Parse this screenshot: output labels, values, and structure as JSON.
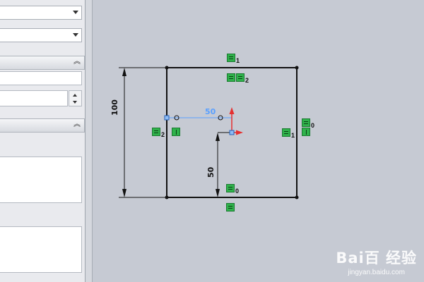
{
  "panel": {
    "combo1_value": "",
    "combo2_value": "",
    "section1_collapse_icon": "chevron-double-up-icon",
    "section2_collapse_icon": "chevron-double-up-icon",
    "field_value": "",
    "spin_value": ""
  },
  "sketch": {
    "dimension_height": "100",
    "dimension_horizontal": "50",
    "dimension_vertical": "50",
    "relations": [
      {
        "icon": "horizontal-relation-icon",
        "sub": "1"
      },
      {
        "icon": "horizontal-relation-icon",
        "sub": "2"
      },
      {
        "icon": "horizontal-relation-icon",
        "sub": "2"
      },
      {
        "icon": "vertical-relation-icon",
        "sub": ""
      },
      {
        "icon": "horizontal-relation-icon",
        "sub": "0"
      },
      {
        "icon": "vertical-relation-icon",
        "sub": ""
      },
      {
        "icon": "horizontal-relation-icon",
        "sub": "1"
      },
      {
        "icon": "horizontal-relation-icon",
        "sub": "0"
      },
      {
        "icon": "horizontal-relation-icon",
        "sub": ""
      }
    ]
  },
  "watermark": {
    "logo": "Bai百 经验",
    "url": "jingyan.baidu.com"
  },
  "colors": {
    "canvas": "#c6cad3",
    "relation_badge": "#2fb24b",
    "driving_dim": "#5aa0ff",
    "axis_x": "#e53030",
    "axis_y": "#e53030"
  }
}
